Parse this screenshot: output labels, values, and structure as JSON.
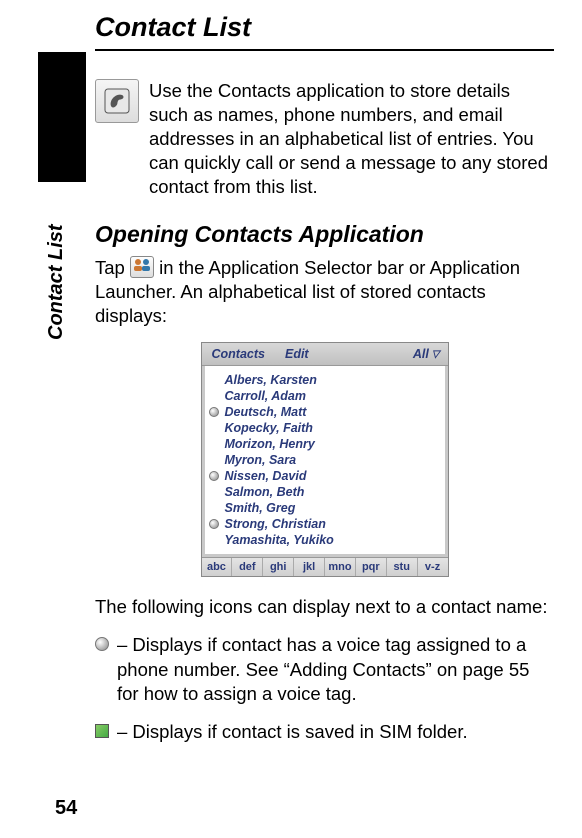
{
  "chapter": {
    "title": "Contact List"
  },
  "sidebar": {
    "label": "Contact List"
  },
  "intro": {
    "icon": "contacts-app-icon",
    "line1": "Use the Contacts application to store details such as names, phone numbers, and email addresses in an alphabetical list of entries. You can quickly call or send a message to any stored contact from this list."
  },
  "section1": {
    "title": "Opening Contacts Application",
    "para1_pre": "Tap ",
    "para1_post": " in the Application Selector bar or Application Launcher. An alphabetical list of stored contacts displays:"
  },
  "screenshot": {
    "menu1": "Contacts",
    "menu2": "Edit",
    "filter": "All",
    "items": [
      {
        "icon": null,
        "name": "Albers, Karsten"
      },
      {
        "icon": null,
        "name": "Carroll, Adam"
      },
      {
        "icon": "voice",
        "name": "Deutsch, Matt"
      },
      {
        "icon": null,
        "name": "Kopecky, Faith"
      },
      {
        "icon": null,
        "name": "Morizon, Henry"
      },
      {
        "icon": null,
        "name": "Myron, Sara"
      },
      {
        "icon": "voice",
        "name": "Nissen, David"
      },
      {
        "icon": null,
        "name": "Salmon, Beth"
      },
      {
        "icon": null,
        "name": "Smith, Greg"
      },
      {
        "icon": "voice",
        "name": "Strong, Christian"
      },
      {
        "icon": null,
        "name": "Yamashita, Yukiko"
      }
    ],
    "keys": [
      "abc",
      "def",
      "ghi",
      "jkl",
      "mno",
      "pqr",
      "stu",
      "v-z"
    ]
  },
  "afterShot": {
    "lead": "The following icons can display next to a contact name:",
    "voice_desc": "– Displays if contact has a voice tag assigned to a phone number. See “Adding Contacts” on page 55 for how to assign a voice tag.",
    "sim_desc": "– Displays if contact is saved in SIM folder."
  },
  "page": {
    "number": "54"
  }
}
